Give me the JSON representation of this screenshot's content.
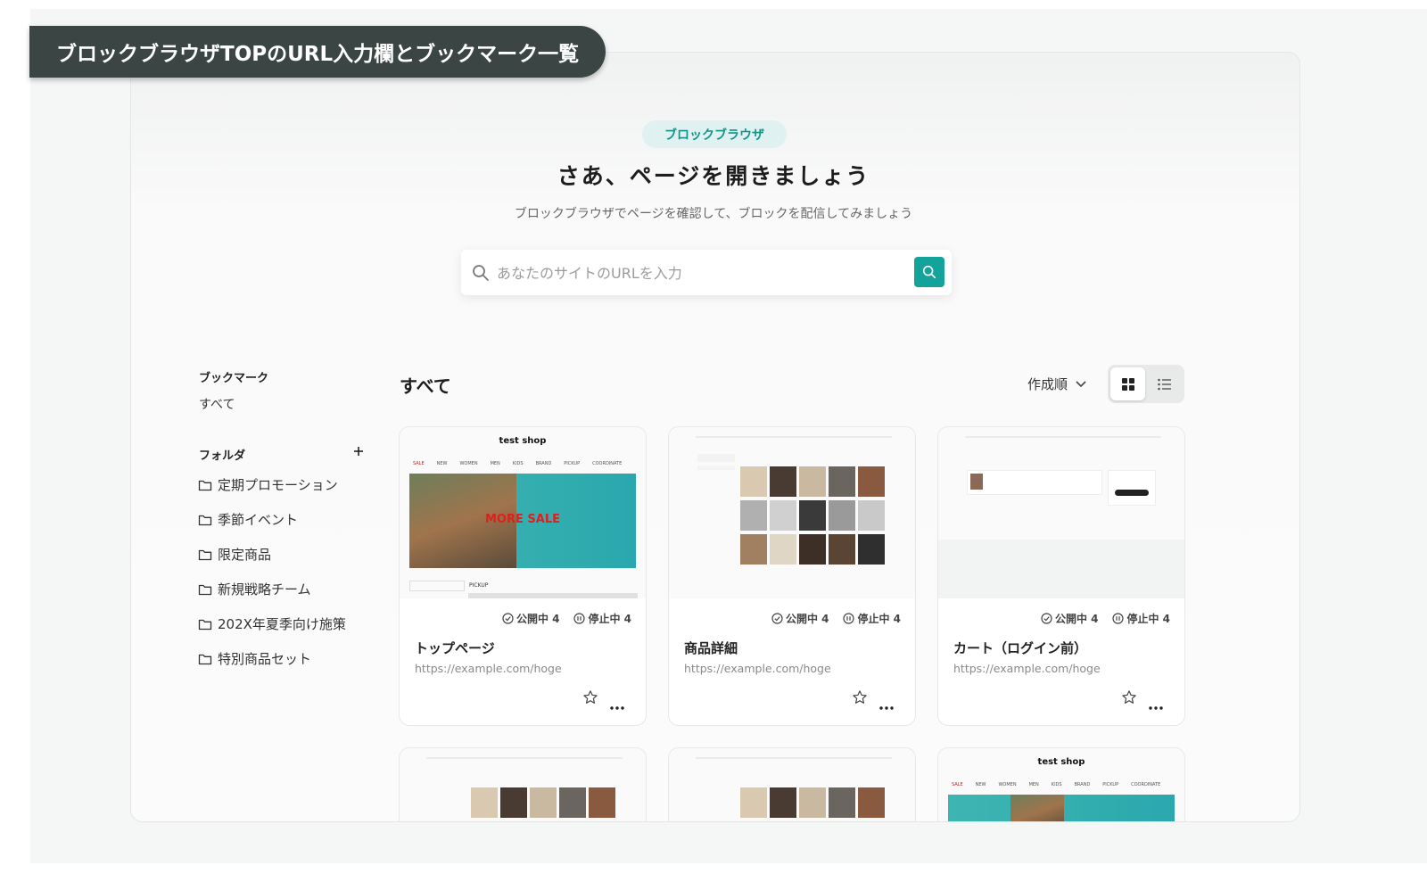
{
  "banner": {
    "title": "ブロックブラウザTOPのURL入力欄とブックマーク一覧"
  },
  "hero": {
    "pill": "ブロックブラウザ",
    "headline": "さあ、ページを開きましょう",
    "subtitle": "ブロックブラウザでページを確認して、ブロックを配信してみましょう"
  },
  "search": {
    "placeholder": "あなたのサイトのURLを入力"
  },
  "sidebar": {
    "bookmark_title": "ブックマーク",
    "all_label": "すべて",
    "folder_title": "フォルダ",
    "folders": [
      "定期プロモーション",
      "季節イベント",
      "限定商品",
      "新規戦略チーム",
      "202X年夏季向け施策",
      "特別商品セット"
    ]
  },
  "main": {
    "section_title": "すべて",
    "sort_label": "作成順",
    "cards": [
      {
        "title": "トップページ",
        "url": "https://example.com/hoge",
        "published": "公開中 4",
        "stopped": "停止中 4",
        "shop_name": "test shop",
        "hero_text": "MORE SALE"
      },
      {
        "title": "商品詳細",
        "url": "https://example.com/hoge",
        "published": "公開中 4",
        "stopped": "停止中 4"
      },
      {
        "title": "カート（ログイン前）",
        "url": "https://example.com/hoge",
        "published": "公開中 4",
        "stopped": "停止中 4"
      }
    ],
    "partial_cards": [
      {
        "shop_name": "test shop"
      }
    ]
  },
  "colors": {
    "accent": "#13a39a",
    "banner_bg": "#3b4544",
    "pill_bg": "#dff1f0"
  }
}
